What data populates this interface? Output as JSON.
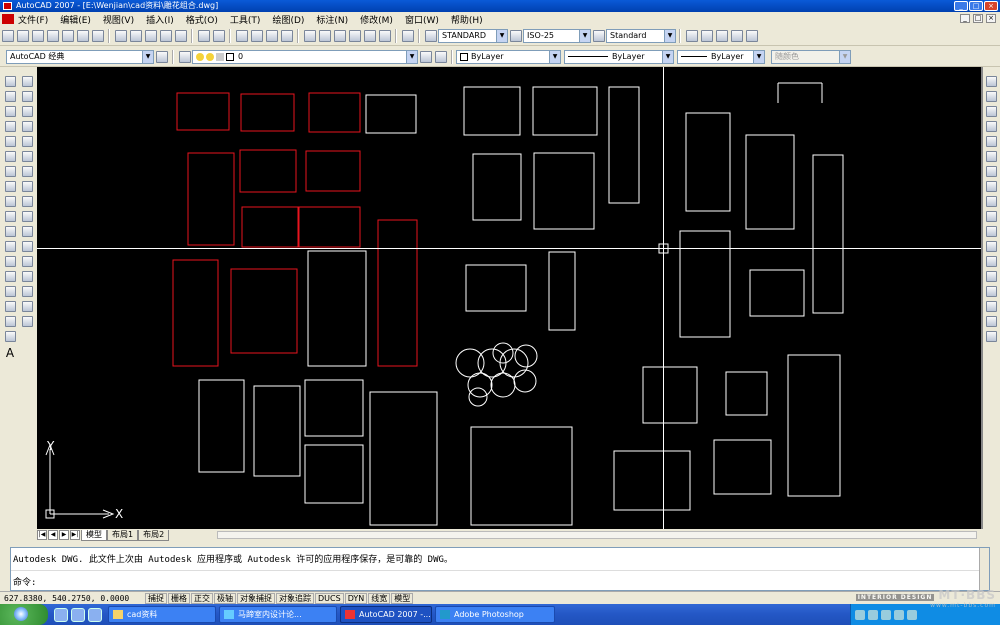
{
  "window": {
    "title": "AutoCAD 2007 - [E:\\Wenjian\\cad资料\\雕花组合.dwg]"
  },
  "menu": [
    "文件(F)",
    "编辑(E)",
    "视图(V)",
    "插入(I)",
    "格式(O)",
    "工具(T)",
    "绘图(D)",
    "标注(N)",
    "修改(M)",
    "窗口(W)",
    "帮助(H)"
  ],
  "toolbar": {
    "text_style": "STANDARD",
    "dim_style": "ISO-25",
    "table_style": "Standard",
    "workspace": "AutoCAD 经典",
    "layer": "0",
    "color": "ByLayer",
    "linetype": "ByLayer",
    "lineweight": "ByLayer",
    "plotstyle": "随颜色"
  },
  "ucs": {
    "x_label": "X",
    "y_label": "Y"
  },
  "layout_tabs": [
    "模型",
    "布局1",
    "布局2"
  ],
  "command": {
    "history": "Autodesk DWG.   此文件上次由 Autodesk 应用程序或 Autodesk 许可的应用程序保存，是可靠的 DWG。",
    "prompt": "命令:"
  },
  "status": {
    "coords": "627.8380, 540.2750, 0.0000",
    "toggles": [
      "捕捉",
      "栅格",
      "正交",
      "极轴",
      "对象捕捉",
      "对象追踪",
      "DUCS",
      "DYN",
      "线宽",
      "模型"
    ]
  },
  "taskbar": {
    "items": [
      "cad资料",
      "马蹄室内设计论...",
      "AutoCAD 2007 -...",
      "Adobe Photoshop"
    ],
    "active_index": 2
  },
  "watermark": {
    "brand": "MT·BBS",
    "sub": "www.mt-bbs.com",
    "badge": "INTERIOR DESIGN"
  },
  "colors": {
    "red_panel": "#e8141e",
    "white_panel": "#ffffff",
    "canvas": "#000000"
  }
}
